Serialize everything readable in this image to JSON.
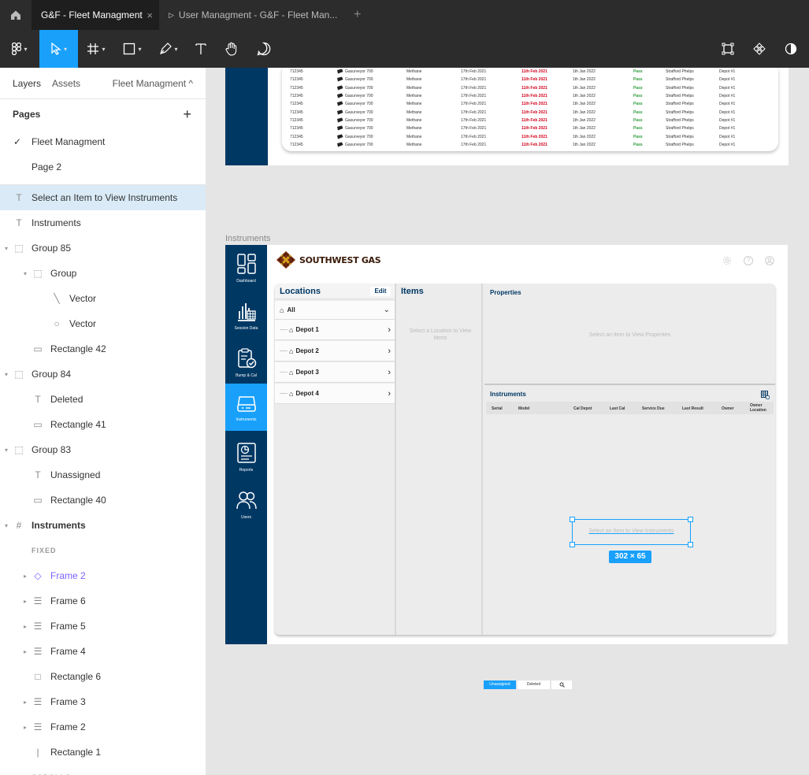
{
  "tabs": [
    {
      "label": "G&F - Fleet Managment",
      "close": "×"
    },
    {
      "label": "User Managment - G&F - Fleet Man..."
    }
  ],
  "tab_plus": "+",
  "sidebar": {
    "tab_layers": "Layers",
    "tab_assets": "Assets",
    "page_name": "Fleet Managment ^",
    "pages_title": "Pages",
    "pages_add": "+",
    "pages": [
      {
        "label": "Fleet Managment",
        "check": "✓"
      },
      {
        "label": "Page 2"
      }
    ],
    "layers": [
      {
        "label": "Select an Item to View Instruments",
        "icon": "T"
      },
      {
        "label": "Instruments",
        "icon": "T"
      },
      {
        "label": "Group 85",
        "icon": "⬚"
      },
      {
        "label": "Group",
        "icon": "⬚"
      },
      {
        "label": "Vector",
        "icon": "╲"
      },
      {
        "label": "Vector",
        "icon": "○"
      },
      {
        "label": "Rectangle 42",
        "icon": "▭"
      },
      {
        "label": "Group 84",
        "icon": "⬚"
      },
      {
        "label": "Deleted",
        "icon": "T"
      },
      {
        "label": "Rectangle 41",
        "icon": "▭"
      },
      {
        "label": "Group 83",
        "icon": "⬚"
      },
      {
        "label": "Unassigned",
        "icon": "T"
      },
      {
        "label": "Rectangle 40",
        "icon": "▭"
      },
      {
        "label": "Instruments",
        "icon": "#"
      },
      {
        "label": "FIXED"
      },
      {
        "label": "Frame 2",
        "icon": "◇"
      },
      {
        "label": "Frame 6",
        "icon": "☰"
      },
      {
        "label": "Frame 5",
        "icon": "☰"
      },
      {
        "label": "Frame 4",
        "icon": "☰"
      },
      {
        "label": "Rectangle 6",
        "icon": "□"
      },
      {
        "label": "Frame 3",
        "icon": "☰"
      },
      {
        "label": "Frame 2",
        "icon": "☰"
      },
      {
        "label": "Rectangle 1",
        "icon": "|"
      },
      {
        "label": "SCROLLS"
      }
    ]
  },
  "top_table": {
    "rows": [
      {
        "serial": "712345",
        "model": "Gasurveyor 700",
        "gas": "Methane",
        "cal": "17th Feb 2021",
        "due": "11th Feb 2021",
        "last": "1th Jan 2022",
        "result": "Pass",
        "owner": "Strafford Phelps",
        "depot": "Depot #1"
      },
      {
        "serial": "712345",
        "model": "Gasurveyor 700",
        "gas": "Methane",
        "cal": "17th Feb 2021",
        "due": "11th Feb 2021",
        "last": "1th Jan 2022",
        "result": "Pass",
        "owner": "Strafford Phelps",
        "depot": "Depot #1"
      },
      {
        "serial": "712345",
        "model": "Gasurveyor 700",
        "gas": "Methane",
        "cal": "17th Feb 2021",
        "due": "11th Feb 2021",
        "last": "1th Jan 2022",
        "result": "Pass",
        "owner": "Strafford Phelps",
        "depot": "Depot #1"
      },
      {
        "serial": "712345",
        "model": "Gasurveyor 700",
        "gas": "Methane",
        "cal": "17th Feb 2021",
        "due": "11th Feb 2021",
        "last": "1th Jan 2022",
        "result": "Pass",
        "owner": "Strafford Phelps",
        "depot": "Depot #1"
      },
      {
        "serial": "712345",
        "model": "Gasurveyor 700",
        "gas": "Methane",
        "cal": "17th Feb 2021",
        "due": "11th Feb 2021",
        "last": "1th Jan 2022",
        "result": "Pass",
        "owner": "Strafford Phelps",
        "depot": "Depot #1"
      },
      {
        "serial": "712345",
        "model": "Gasurveyor 700",
        "gas": "Methane",
        "cal": "17th Feb 2021",
        "due": "11th Feb 2021",
        "last": "1th Jan 2022",
        "result": "Pass",
        "owner": "Strafford Phelps",
        "depot": "Depot #1"
      },
      {
        "serial": "712345",
        "model": "Gasurveyor 700",
        "gas": "Methane",
        "cal": "17th Feb 2021",
        "due": "11th Feb 2021",
        "last": "1th Jan 2022",
        "result": "Pass",
        "owner": "Strafford Phelps",
        "depot": "Depot #1"
      },
      {
        "serial": "712345",
        "model": "Gasurveyor 700",
        "gas": "Methane",
        "cal": "17th Feb 2021",
        "due": "11th Feb 2021",
        "last": "1th Jan 2022",
        "result": "Pass",
        "owner": "Strafford Phelps",
        "depot": "Depot #1"
      },
      {
        "serial": "712345",
        "model": "Gasurveyor 700",
        "gas": "Methane",
        "cal": "17th Feb 2021",
        "due": "11th Feb 2021",
        "last": "1th Jan 2022",
        "result": "Pass",
        "owner": "Strafford Phelps",
        "depot": "Depot #1"
      },
      {
        "serial": "712345",
        "model": "Gasurveyor 700",
        "gas": "Methane",
        "cal": "17th Feb 2021",
        "due": "11th Feb 2021",
        "last": "1th Jan 2022",
        "result": "Pass",
        "owner": "Strafford Phelps",
        "depot": "Depot #1"
      }
    ]
  },
  "frame_label": "Instruments",
  "app": {
    "logo_text": "SOUTHWEST GAS",
    "nav": [
      {
        "label": "Dashboard",
        "icon": "dashboard-icon"
      },
      {
        "label": "Session Data",
        "icon": "session-data-icon"
      },
      {
        "label": "Bump & Cal",
        "icon": "clipboard-check-icon"
      },
      {
        "label": "Instruments",
        "icon": "instrument-icon"
      },
      {
        "label": "Reports",
        "icon": "report-icon"
      },
      {
        "label": "Users",
        "icon": "users-icon"
      }
    ],
    "locations_title": "Locations",
    "edit_label": "Edit",
    "all_label": "All",
    "depots": [
      "Depot 1",
      "Depot 2",
      "Depot 3",
      "Depot 4"
    ],
    "items_title": "Items",
    "items_placeholder": "Select a Location to View Items",
    "properties_title": "Properties",
    "properties_placeholder": "Select an Item to View Properites",
    "instruments_title": "Instruments",
    "columns": [
      "Serial",
      "Model",
      "Cal Depot",
      "Last Cal",
      "Service Due",
      "Last Result",
      "Owner",
      "Owner Location"
    ],
    "instruments_placeholder": "Select an Item to View Instruments",
    "size_label": "302 × 65"
  },
  "filters": {
    "unassigned": "Unassigned",
    "deleted": "Deleted",
    "search_icon": "search-icon"
  },
  "colors": {
    "accent": "#18a0fb",
    "nav": "#003864",
    "overdue": "#d0021b",
    "pass": "#2e9e3e",
    "purple": "#7b61ff"
  }
}
